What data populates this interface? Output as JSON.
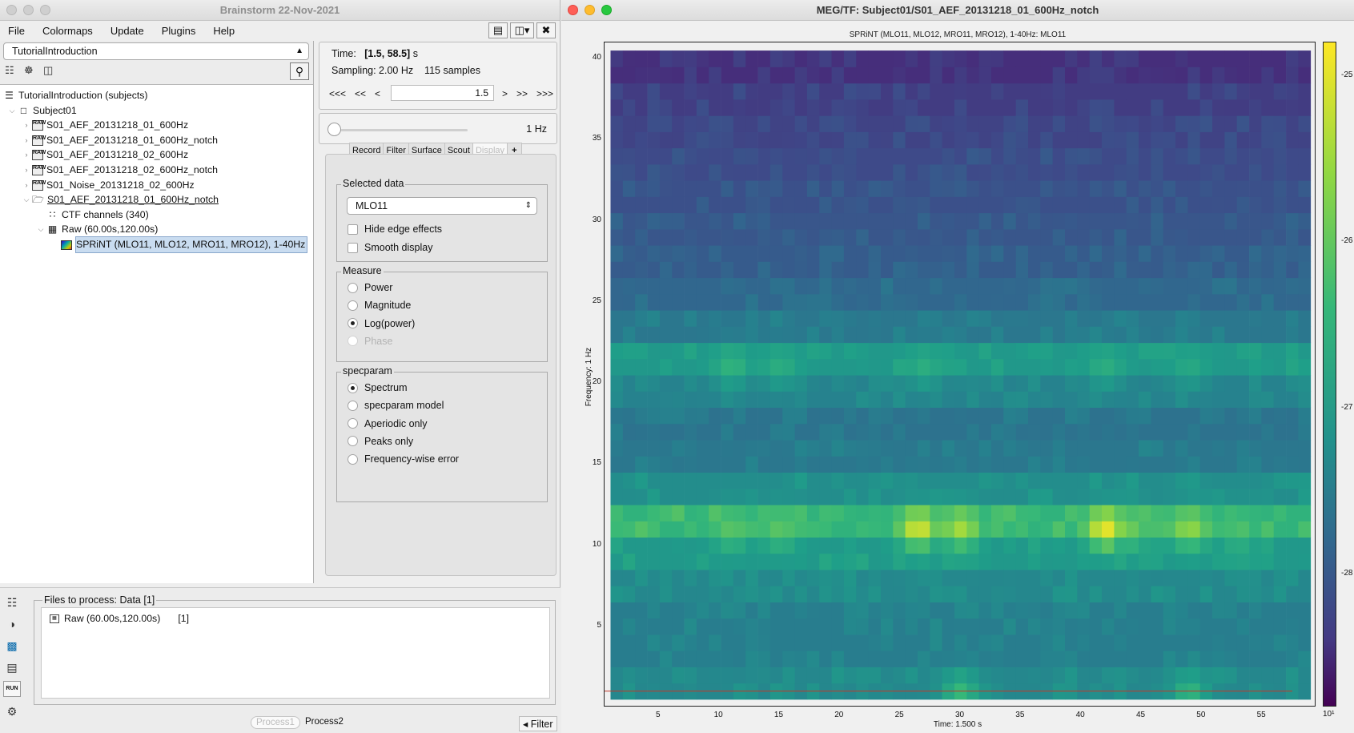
{
  "left_window": {
    "title": "Brainstorm 22-Nov-2021",
    "menu": [
      "File",
      "Colormaps",
      "Update",
      "Plugins",
      "Help"
    ],
    "protocol": "TutorialIntroduction",
    "tree": [
      {
        "label": "TutorialIntroduction (subjects)",
        "level": 0,
        "arrow": "",
        "icon": "subjects"
      },
      {
        "label": "Subject01",
        "level": 1,
        "arrow": "⌵",
        "icon": "subject"
      },
      {
        "label": "S01_AEF_20131218_01_600Hz",
        "level": 2,
        "arrow": "›",
        "icon": "raw"
      },
      {
        "label": "S01_AEF_20131218_01_600Hz_notch",
        "level": 2,
        "arrow": "›",
        "icon": "raw"
      },
      {
        "label": "S01_AEF_20131218_02_600Hz",
        "level": 2,
        "arrow": "›",
        "icon": "raw"
      },
      {
        "label": "S01_AEF_20131218_02_600Hz_notch",
        "level": 2,
        "arrow": "›",
        "icon": "raw"
      },
      {
        "label": "S01_Noise_20131218_02_600Hz",
        "level": 2,
        "arrow": "›",
        "icon": "raw"
      },
      {
        "label": "S01_AEF_20131218_01_600Hz_notch",
        "level": 2,
        "arrow": "⌵",
        "icon": "folder",
        "underline": true
      },
      {
        "label": "CTF channels (340)",
        "level": 3,
        "arrow": "",
        "icon": "channels"
      },
      {
        "label": "Raw (60.00s,120.00s)",
        "level": 3,
        "arrow": "⌵",
        "icon": "data"
      },
      {
        "label": "SPRiNT (MLO11, MLO12, MRO11, MRO12), 1-40Hz",
        "level": 4,
        "arrow": "",
        "icon": "tf",
        "selected": true
      }
    ]
  },
  "time_panel": {
    "time_label": "Time:",
    "time_value": "[1.5, 58.5]",
    "time_unit": "s",
    "sampling": "Sampling: 2.00 Hz",
    "samples": "115 samples",
    "nav_back": [
      "<<<",
      "<<",
      "<"
    ],
    "nav_fwd": [
      ">",
      ">>",
      ">>>"
    ],
    "current_time": "1.5"
  },
  "freq_panel": {
    "value": "1 Hz",
    "slider_fraction": 0.0
  },
  "tabs": [
    "Record",
    "Filter",
    "Surface",
    "Scout",
    "Display",
    "+"
  ],
  "active_tab": "Display",
  "display": {
    "selected_data_title": "Selected data",
    "selected_data": "MLO11",
    "hide_edge": "Hide edge effects",
    "smooth": "Smooth display",
    "measure_title": "Measure",
    "measures": [
      "Power",
      "Magnitude",
      "Log(power)",
      "Phase"
    ],
    "measure_selected": "Log(power)",
    "specparam_title": "specparam",
    "spec_options": [
      "Spectrum",
      "specparam model",
      "Aperiodic only",
      "Peaks only",
      "Frequency-wise error"
    ],
    "spec_selected": "Spectrum"
  },
  "process": {
    "files_title": "Files to process: Data [1]",
    "file_label": "Raw (60.00s,120.00s)",
    "file_count": "[1]",
    "run": "RUN",
    "tab1": "Process1",
    "tab2": "Process2",
    "filter": "Filter"
  },
  "right_window": {
    "title": "MEG/TF: Subject01/S01_AEF_20131218_01_600Hz_notch",
    "plot_title": "SPRiNT (MLO11, MLO12, MRO11, MRO12), 1-40Hz: MLO11",
    "ylabel": "Frequency: 1 Hz",
    "xlabel": "Time: 1.500 s",
    "yticks": [
      "40",
      "35",
      "30",
      "25",
      "20",
      "15",
      "10",
      "5"
    ],
    "xticks": [
      "5",
      "10",
      "15",
      "20",
      "25",
      "30",
      "35",
      "40",
      "45",
      "50",
      "55"
    ],
    "colorbar_ticks": [
      "-25",
      "-26",
      "-27",
      "-28"
    ],
    "colorbar_exp": "10¹"
  },
  "chart_data": {
    "type": "heatmap",
    "title": "SPRiNT (MLO11, MLO12, MRO11, MRO12), 1-40Hz: MLO11",
    "xlabel": "Time: 1.500 s",
    "ylabel": "Frequency: 1 Hz",
    "xlim": [
      1.5,
      58.5
    ],
    "ylim": [
      1,
      40
    ],
    "x_step": 2.0,
    "y_step": 2.0,
    "colormap": "viridis",
    "clim": [
      -28.8,
      -24.8
    ],
    "colorbar_ticks": [
      -25,
      -26,
      -27,
      -28
    ],
    "baseline_by_freq": [
      {
        "f": 1,
        "v": -26.7
      },
      {
        "f": 3,
        "v": -26.9
      },
      {
        "f": 5,
        "v": -26.9
      },
      {
        "f": 7,
        "v": -26.7
      },
      {
        "f": 9,
        "v": -26.4
      },
      {
        "f": 11,
        "v": -25.9
      },
      {
        "f": 13,
        "v": -26.6
      },
      {
        "f": 15,
        "v": -27.0
      },
      {
        "f": 17,
        "v": -27.1
      },
      {
        "f": 19,
        "v": -26.8
      },
      {
        "f": 21,
        "v": -26.4
      },
      {
        "f": 23,
        "v": -27.0
      },
      {
        "f": 25,
        "v": -27.3
      },
      {
        "f": 27,
        "v": -27.5
      },
      {
        "f": 29,
        "v": -27.6
      },
      {
        "f": 31,
        "v": -27.7
      },
      {
        "f": 33,
        "v": -27.8
      },
      {
        "f": 35,
        "v": -27.9
      },
      {
        "f": 37,
        "v": -28.0
      },
      {
        "f": 39,
        "v": -28.2
      }
    ],
    "peaks": [
      {
        "t": 26.5,
        "f": 11,
        "v": -25.0
      },
      {
        "t": 42.0,
        "f": 11,
        "v": -24.9
      },
      {
        "t": 30.0,
        "f": 11,
        "v": -25.2
      },
      {
        "t": 49.0,
        "f": 11,
        "v": -25.3
      },
      {
        "t": 11.0,
        "f": 11,
        "v": -25.6
      },
      {
        "t": 15.0,
        "f": 11,
        "v": -25.6
      },
      {
        "t": 44.0,
        "f": 11,
        "v": -25.5
      },
      {
        "t": 53.0,
        "f": 11,
        "v": -25.7
      },
      {
        "t": 11.0,
        "f": 21,
        "v": -25.9
      },
      {
        "t": 15.0,
        "f": 21,
        "v": -26.0
      },
      {
        "t": 27.0,
        "f": 21,
        "v": -26.0
      },
      {
        "t": 42.0,
        "f": 21,
        "v": -26.0
      },
      {
        "t": 49.0,
        "f": 21,
        "v": -26.1
      },
      {
        "t": 30.0,
        "f": 1,
        "v": -25.8
      },
      {
        "t": 49.0,
        "f": 1,
        "v": -25.9
      }
    ]
  }
}
